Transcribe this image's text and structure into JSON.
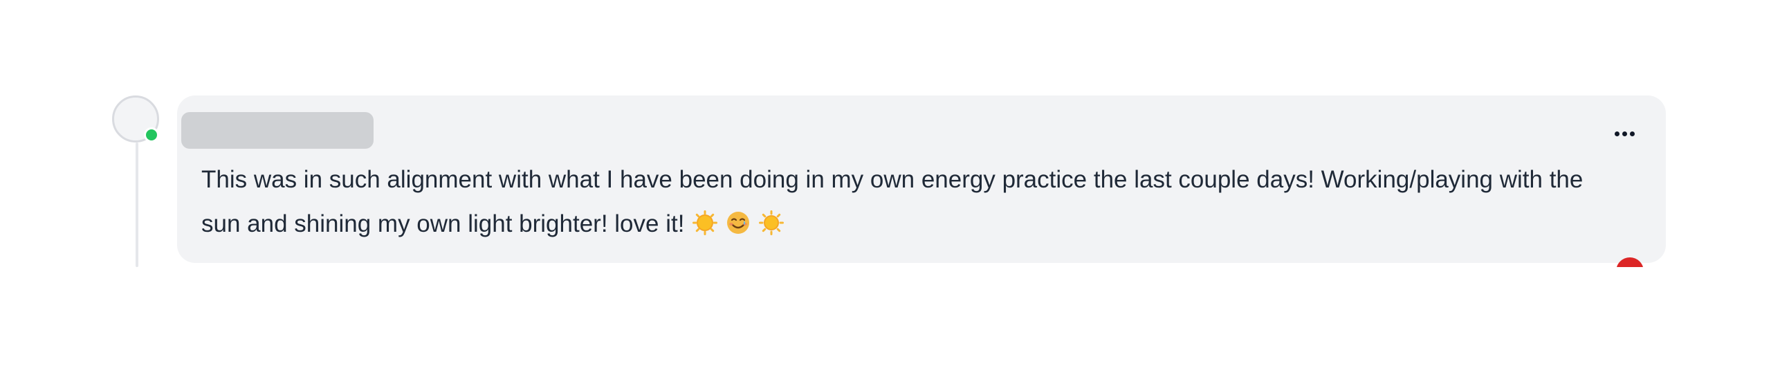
{
  "comment": {
    "author_name": "",
    "text": "This was in such alignment with what I have been doing in my own energy practice the last couple days! Working/playing with the sun and shining my own light brighter! love it!",
    "emojis": [
      "sun-emoji",
      "smiling-face-with-tear-emoji",
      "sun-emoji"
    ],
    "online": true
  },
  "icons": {
    "more_options": "more-horizontal-icon"
  },
  "colors": {
    "bubble_background": "#f2f3f5",
    "text": "#1f2937",
    "presence_online": "#22c55e",
    "avatar_border": "#d9dbe0",
    "name_placeholder": "#cfd1d4",
    "reaction_badge": "#dc2626"
  }
}
